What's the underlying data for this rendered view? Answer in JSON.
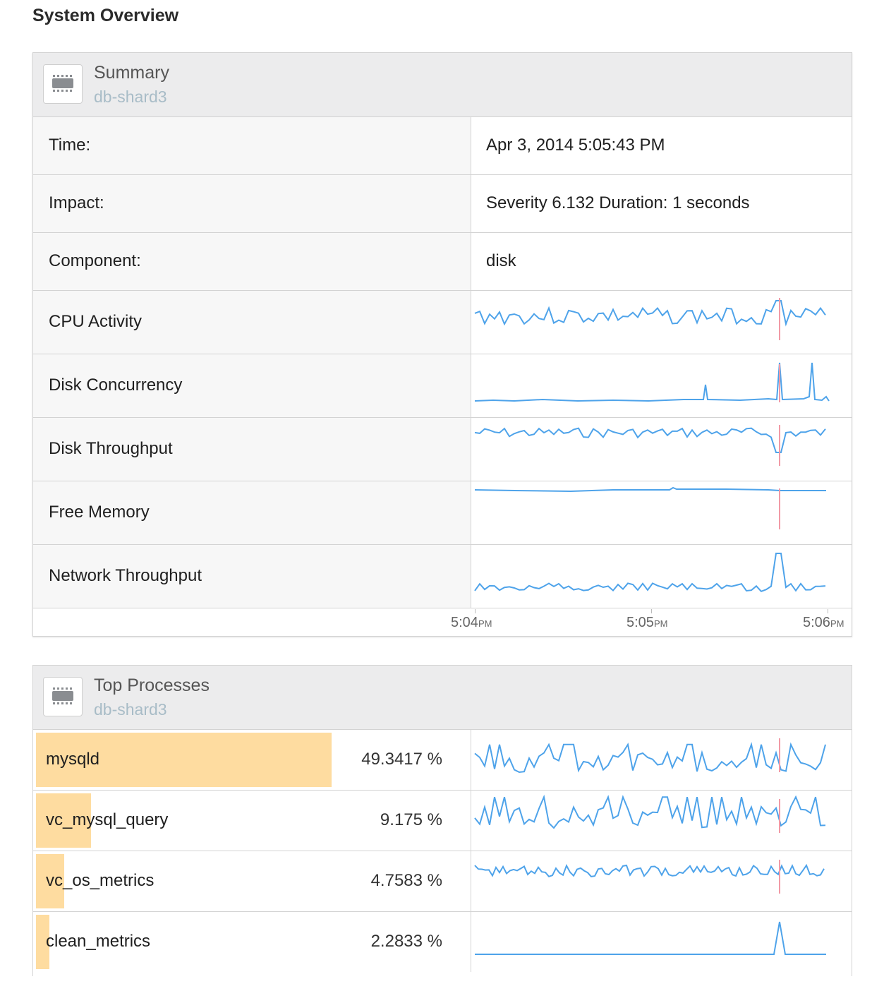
{
  "page": {
    "title": "System Overview"
  },
  "summary": {
    "title": "Summary",
    "host": "db-shard3",
    "rows": [
      {
        "label": "Time:",
        "value": "Apr 3, 2014 5:05:43 PM"
      },
      {
        "label": "Impact:",
        "value": "Severity 6.132 Duration: 1 seconds"
      },
      {
        "label": "Component:",
        "value": "disk"
      }
    ],
    "metrics": [
      {
        "label": "CPU Activity"
      },
      {
        "label": "Disk Concurrency"
      },
      {
        "label": "Disk Throughput"
      },
      {
        "label": "Free Memory"
      },
      {
        "label": "Network Throughput"
      }
    ],
    "time_ticks": [
      {
        "time": "5:04",
        "suffix": "PM"
      },
      {
        "time": "5:05",
        "suffix": "PM"
      },
      {
        "time": "5:06",
        "suffix": "PM"
      }
    ]
  },
  "processes": {
    "title": "Top Processes",
    "host": "db-shard3",
    "items": [
      {
        "name": "mysqld",
        "percent": "49.3417 %",
        "share": 0.493417
      },
      {
        "name": "vc_mysql_query",
        "percent": "9.175 %",
        "share": 0.09175
      },
      {
        "name": "vc_os_metrics",
        "percent": "4.7583 %",
        "share": 0.047583
      },
      {
        "name": "clean_metrics",
        "percent": "2.2833 %",
        "share": 0.022833
      }
    ]
  },
  "colors": {
    "line": "#4ea3ea",
    "marker": "#f29aa6",
    "process_bar": "#fedca0",
    "header_bg": "#ececed",
    "host_text": "#a8bcc7"
  }
}
